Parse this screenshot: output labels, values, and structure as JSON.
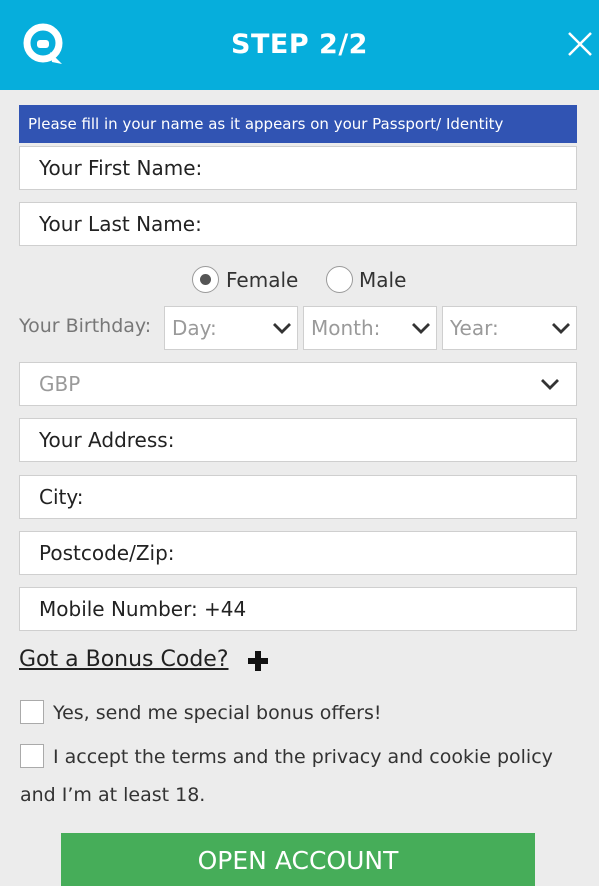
{
  "header": {
    "title": "STEP 2/2",
    "logo_icon": "chat-bubble-logo-icon",
    "close_icon": "close-icon",
    "color": "#06aedc"
  },
  "notice": {
    "text": "Please fill in your name as it appears on your Passport/ Identity",
    "color": "#3154b3"
  },
  "fields": {
    "first_name": "Your First Name:",
    "last_name": "Your Last Name:",
    "address": "Your Address:",
    "city": "City:",
    "postcode": "Postcode/Zip:",
    "mobile": "Mobile Number: +44"
  },
  "gender": {
    "female": "Female",
    "male": "Male",
    "selected": "Female"
  },
  "birthday": {
    "label": "Your Birthday:",
    "day": "Day:",
    "month": "Month:",
    "year": "Year:"
  },
  "currency": {
    "value": "GBP"
  },
  "bonus": {
    "label": "Got a Bonus Code?",
    "icon": "plus-icon"
  },
  "checkboxes": {
    "offers": "Yes, send me special bonus offers!",
    "terms_line1": "I accept the terms and the privacy and cookie policy",
    "terms_line2": "and I’m at least 18."
  },
  "submit": {
    "label": "OPEN ACCOUNT",
    "color": "#46ad59"
  }
}
